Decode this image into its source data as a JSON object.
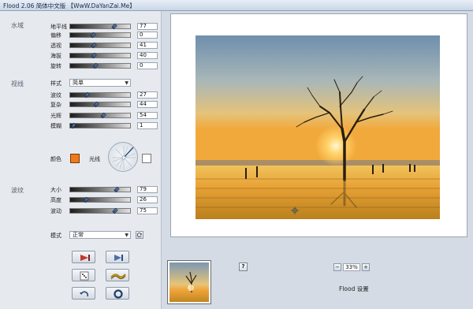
{
  "window": {
    "title": "Flood 2.06 简体中文版 【WwW.DaYanZai.Me】"
  },
  "sections": {
    "water": "水域",
    "view": "视线",
    "ripple": "波纹"
  },
  "water_params": [
    {
      "label": "地平线",
      "value": "77",
      "pos": 0.74
    },
    {
      "label": "偏移",
      "value": "0",
      "pos": 0.38
    },
    {
      "label": "透视",
      "value": "41",
      "pos": 0.4
    },
    {
      "label": "海拔",
      "value": "40",
      "pos": 0.4
    },
    {
      "label": "旋转",
      "value": "0",
      "pos": 0.42
    }
  ],
  "view": {
    "style_label": "样式",
    "style_value": "简单",
    "params": [
      {
        "label": "波纹",
        "value": "27",
        "pos": 0.28
      },
      {
        "label": "复杂",
        "value": "44",
        "pos": 0.44
      },
      {
        "label": "光辉",
        "value": "54",
        "pos": 0.55
      },
      {
        "label": "模糊",
        "value": "1",
        "pos": 0.05
      }
    ],
    "color_label": "颜色",
    "color": "#ee7a1a",
    "light_label": "光线",
    "light_color": "#ffffff"
  },
  "ripple_params": [
    {
      "label": "大小",
      "value": "79",
      "pos": 0.78
    },
    {
      "label": "高度",
      "value": "26",
      "pos": 0.26
    },
    {
      "label": "波动",
      "value": "75",
      "pos": 0.75
    }
  ],
  "mode": {
    "label": "模式",
    "value": "正常"
  },
  "buttons": {
    "help": "?",
    "zoom_minus": "−",
    "zoom_plus": "+",
    "zoom_value": "33%"
  },
  "footer": {
    "label": "Flood 设置"
  },
  "colors": {
    "accent": "#ee7a1a",
    "panel": "#e6eaef"
  }
}
